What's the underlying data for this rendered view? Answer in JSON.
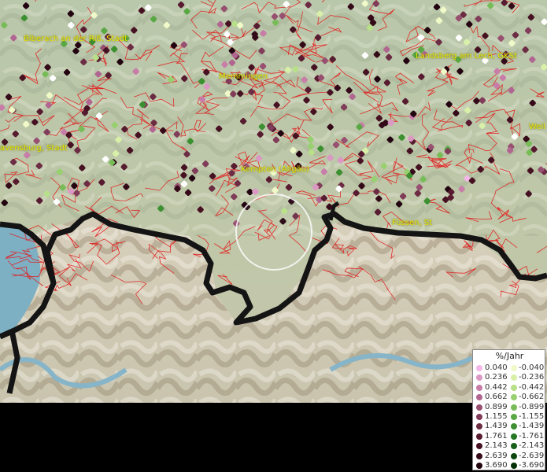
{
  "map": {
    "places": [
      {
        "name": "Biberach an der Riß, Stadt",
        "label": "Biberach an der Riß, Stadt"
      },
      {
        "name": "Memmingen",
        "label": "Memmingen"
      },
      {
        "name": "Landsberg am Lech, GKSt",
        "label": "Landsberg am Lech, GKSt"
      },
      {
        "name": "Ravensburg, Stadt",
        "label": "avensburg, Stadt"
      },
      {
        "name": "Kempten (Allgäu)",
        "label": "Kempten (Allgäu)"
      },
      {
        "name": "Füssen, St",
        "label": "Füssen, St"
      },
      {
        "name": "Weilheim",
        "label": "Weil"
      }
    ]
  },
  "legend": {
    "title": "%/Jahr",
    "positive": [
      {
        "value": "0.040",
        "color": "#f4b8e8"
      },
      {
        "value": "0.236",
        "color": "#dc98c4"
      },
      {
        "value": "0.442",
        "color": "#c87ca8"
      },
      {
        "value": "0.662",
        "color": "#b06690"
      },
      {
        "value": "0.899",
        "color": "#985070"
      },
      {
        "value": "1.155",
        "color": "#803c58"
      },
      {
        "value": "1.439",
        "color": "#6c2c44"
      },
      {
        "value": "1.761",
        "color": "#581c30"
      },
      {
        "value": "2.143",
        "color": "#461222"
      },
      {
        "value": "2.639",
        "color": "#340a18"
      },
      {
        "value": "3.690",
        "color": "#220410"
      }
    ],
    "negative": [
      {
        "value": "-0.040",
        "color": "#f0fac8"
      },
      {
        "value": "-0.236",
        "color": "#d8f0a8"
      },
      {
        "value": "-0.442",
        "color": "#b8e088"
      },
      {
        "value": "-0.662",
        "color": "#98d070"
      },
      {
        "value": "-0.899",
        "color": "#78bc58"
      },
      {
        "value": "-1.155",
        "color": "#5aa844"
      },
      {
        "value": "-1.439",
        "color": "#3c9030"
      },
      {
        "value": "-1.761",
        "color": "#267822"
      },
      {
        "value": "-2.143",
        "color": "#166018"
      },
      {
        "value": "-2.639",
        "color": "#0c4810"
      },
      {
        "value": "-3.690",
        "color": "#043008"
      }
    ]
  }
}
